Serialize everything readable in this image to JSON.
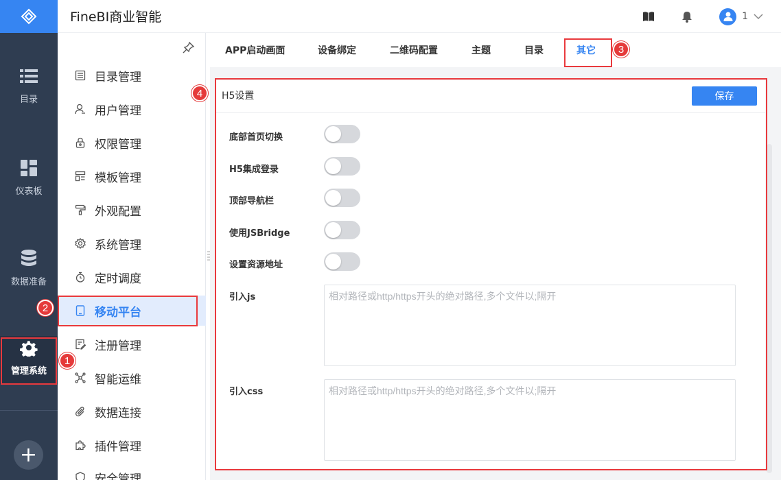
{
  "header": {
    "title": "FineBI商业智能",
    "user": "1"
  },
  "rail": {
    "items": [
      {
        "label": "目录",
        "icon": "list-icon"
      },
      {
        "label": "仪表板",
        "icon": "dashboard-icon"
      },
      {
        "label": "数据准备",
        "icon": "database-icon"
      },
      {
        "label": "管理系统",
        "icon": "gear-icon"
      }
    ],
    "plus": "+"
  },
  "sidebar": {
    "items": [
      {
        "label": "目录管理",
        "icon": "catalog-icon"
      },
      {
        "label": "用户管理",
        "icon": "user-icon"
      },
      {
        "label": "权限管理",
        "icon": "lock-icon"
      },
      {
        "label": "模板管理",
        "icon": "template-icon"
      },
      {
        "label": "外观配置",
        "icon": "paint-roller-icon"
      },
      {
        "label": "系统管理",
        "icon": "settings-icon"
      },
      {
        "label": "定时调度",
        "icon": "timer-icon"
      },
      {
        "label": "移动平台",
        "icon": "tablet-icon"
      },
      {
        "label": "注册管理",
        "icon": "register-icon"
      },
      {
        "label": "智能运维",
        "icon": "network-icon"
      },
      {
        "label": "数据连接",
        "icon": "paperclip-icon"
      },
      {
        "label": "插件管理",
        "icon": "puzzle-icon"
      },
      {
        "label": "安全管理",
        "icon": "shield-icon"
      }
    ]
  },
  "tabs": [
    "APP启动画面",
    "设备绑定",
    "二维码配置",
    "主题",
    "目录",
    "其它"
  ],
  "panel": {
    "title": "H5设置",
    "save": "保存",
    "toggles": [
      "底部首页切换",
      "H5集成登录",
      "顶部导航栏",
      "使用JSBridge",
      "设置资源地址"
    ],
    "fields": [
      {
        "label": "引入js",
        "placeholder": "相对路径或http/https开头的绝对路径,多个文件以;隔开"
      },
      {
        "label": "引入css",
        "placeholder": "相对路径或http/https开头的绝对路径,多个文件以;隔开"
      }
    ]
  },
  "annotations": [
    "1",
    "2",
    "3",
    "4"
  ],
  "colors": {
    "accent": "#3685f2",
    "rail": "#2f3d51",
    "annotation": "#e53a3a"
  }
}
